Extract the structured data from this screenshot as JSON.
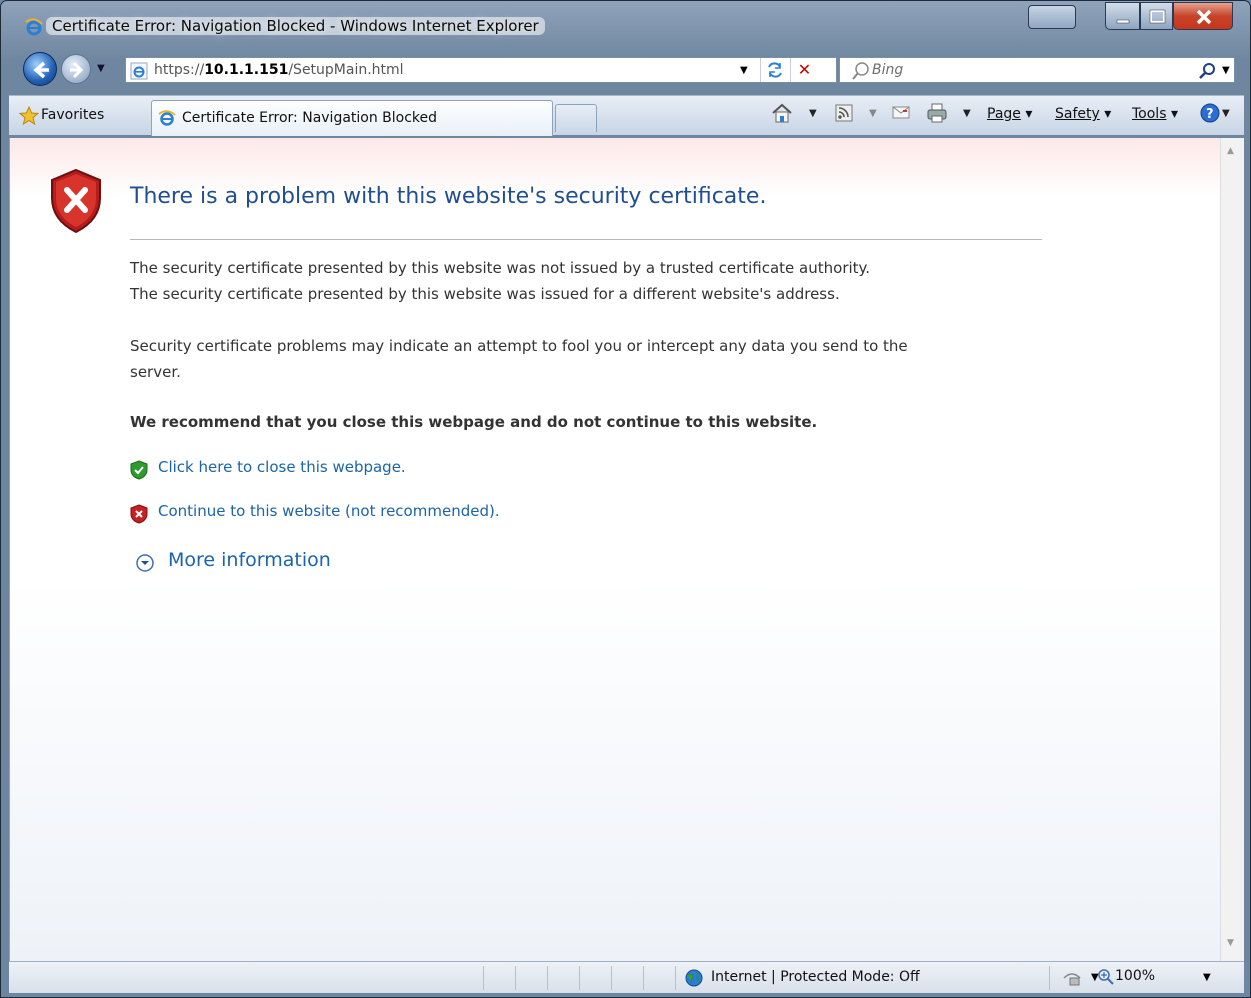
{
  "window": {
    "title": "Certificate Error: Navigation Blocked - Windows Internet Explorer"
  },
  "address_bar": {
    "url_prefix": "https://",
    "url_host": "10.1.1.151",
    "url_path": "/SetupMain.html",
    "search_placeholder": "Bing"
  },
  "command_bar": {
    "favorites_label": "Favorites",
    "tab_label": "Certificate Error: Navigation Blocked",
    "page_label": "Page",
    "safety_label": "Safety",
    "tools_label": "Tools"
  },
  "content": {
    "heading": "There is a problem with this website's security certificate.",
    "para1": "The security certificate presented by this website was not issued by a trusted certificate authority.",
    "para2": "The security certificate presented by this website was issued for a different website's address.",
    "para3": "Security certificate problems may indicate an attempt to fool you or intercept any data you send to the",
    "para3b": "server.",
    "recommend": "We recommend that you close this webpage and do not continue to this website.",
    "link_close": "Click here to close this webpage.",
    "link_continue": "Continue to this website (not recommended).",
    "more_info": "More information"
  },
  "status_bar": {
    "zone": "Internet | Protected Mode: Off",
    "zoom": "100%"
  },
  "colors": {
    "link": "#1a64a8",
    "heading": "#1f4f8f",
    "error_red": "#c62020",
    "safe_green": "#2f9a2f"
  },
  "icons": [
    "ie-logo-icon",
    "back-icon",
    "forward-icon",
    "search-icon",
    "favorites-star-icon",
    "home-icon",
    "feeds-icon",
    "mail-icon",
    "print-icon",
    "help-icon",
    "shield-error-icon",
    "shield-ok-icon",
    "expand-icon",
    "globe-icon",
    "zoom-icon"
  ]
}
